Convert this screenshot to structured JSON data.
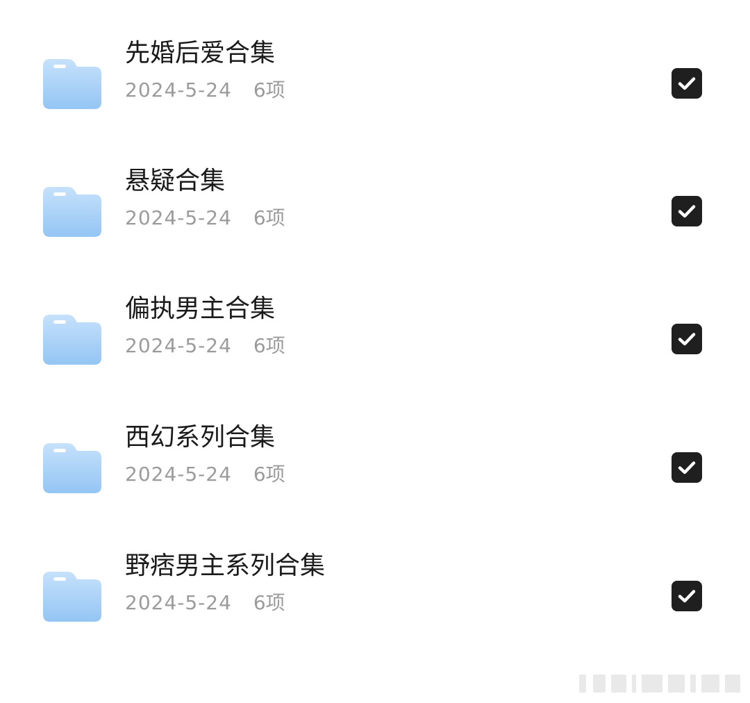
{
  "folders": [
    {
      "name": "先婚后爱合集",
      "date": "2024-5-24",
      "count": "6项",
      "checked": true
    },
    {
      "name": "悬疑合集",
      "date": "2024-5-24",
      "count": "6项",
      "checked": true
    },
    {
      "name": "偏执男主合集",
      "date": "2024-5-24",
      "count": "6项",
      "checked": true
    },
    {
      "name": "西幻系列合集",
      "date": "2024-5-24",
      "count": "6项",
      "checked": true
    },
    {
      "name": "野痞男主系列合集",
      "date": "2024-5-24",
      "count": "6项",
      "checked": true
    }
  ],
  "icons": {
    "folder": "folder-icon",
    "checkbox": "checkbox-checked-icon"
  },
  "colors": {
    "folder_gradient_top": "#c6e1fb",
    "folder_gradient_bottom": "#94c5f4",
    "checkbox_fill": "#1f1f1f",
    "title_text": "#1a1a1a",
    "meta_text": "#9b9b9b"
  }
}
